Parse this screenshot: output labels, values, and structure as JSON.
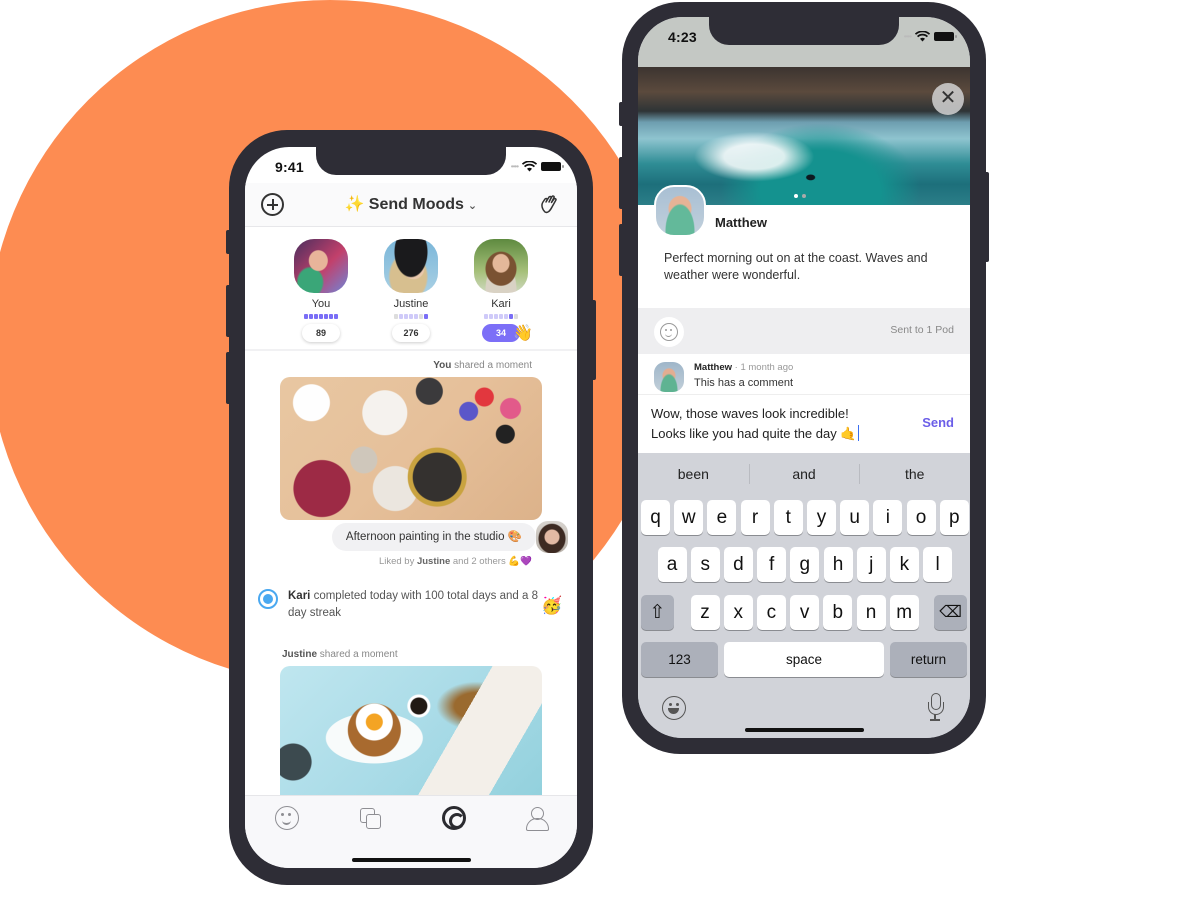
{
  "colors": {
    "background_circle": "#fd8c52",
    "phone_frame": "#2e2d36",
    "accent_purple": "#7c6ff7",
    "send_purple": "#6b5ee8",
    "radio_blue": "#4aa8f0"
  },
  "phone_feed": {
    "status": {
      "time": "9:41"
    },
    "header": {
      "left_icon": "plus-circle-icon",
      "title_emoji": "✨",
      "title": "Send Moods",
      "title_chevron": "⌄",
      "right_icon": "waving-hands-icon",
      "right_glyph": "👋"
    },
    "friends": [
      {
        "name": "You",
        "count": "89",
        "mood_level": 7,
        "active": false
      },
      {
        "name": "Justine",
        "count": "276",
        "mood_level": 5,
        "active": false
      },
      {
        "name": "Kari",
        "count": "34",
        "mood_level": 5,
        "active": true,
        "reaction_emoji": "👋"
      }
    ],
    "feed": {
      "moment1": {
        "author": "You",
        "action": "shared a moment",
        "caption": "Afternoon painting in the studio 🎨",
        "liked_prefix": "Liked by",
        "liked_name": "Justine",
        "liked_suffix": "and 2 others 💪💜"
      },
      "activity": {
        "name": "Kari",
        "text": "completed today with 100 total days and a 8 day streak",
        "emoji": "🥳"
      },
      "moment2": {
        "author": "Justine",
        "action": "shared a moment"
      }
    },
    "tabbar": [
      {
        "name": "moods",
        "icon": "smile-icon",
        "active": false
      },
      {
        "name": "moments",
        "icon": "stack-icon",
        "active": false
      },
      {
        "name": "pods",
        "icon": "spiral-icon",
        "active": true
      },
      {
        "name": "profile",
        "icon": "person-icon",
        "active": false
      }
    ]
  },
  "phone_post": {
    "status": {
      "time": "4:23"
    },
    "close_glyph": "✕",
    "page_indicator": {
      "pages": 2,
      "current": 1
    },
    "post": {
      "author": "Matthew",
      "text": "Perfect morning out on at the coast. Waves and weather were wonderful."
    },
    "actions": {
      "sent_to": "Sent to 1 Pod"
    },
    "comment": {
      "author": "Matthew",
      "time": "· 1 month ago",
      "text": "This has a comment"
    },
    "compose": {
      "line1": "Wow, those waves look incredible!",
      "line2": "Looks like you had quite the day 🤙",
      "send_label": "Send"
    },
    "keyboard": {
      "suggestions": [
        "been",
        "and",
        "the"
      ],
      "row1": [
        "q",
        "w",
        "e",
        "r",
        "t",
        "y",
        "u",
        "i",
        "o",
        "p"
      ],
      "row2": [
        "a",
        "s",
        "d",
        "f",
        "g",
        "h",
        "j",
        "k",
        "l"
      ],
      "row3": [
        "z",
        "x",
        "c",
        "v",
        "b",
        "n",
        "m"
      ],
      "shift_glyph": "⇧",
      "delete_glyph": "⌫",
      "numbers_label": "123",
      "space_label": "space",
      "return_label": "return"
    }
  }
}
